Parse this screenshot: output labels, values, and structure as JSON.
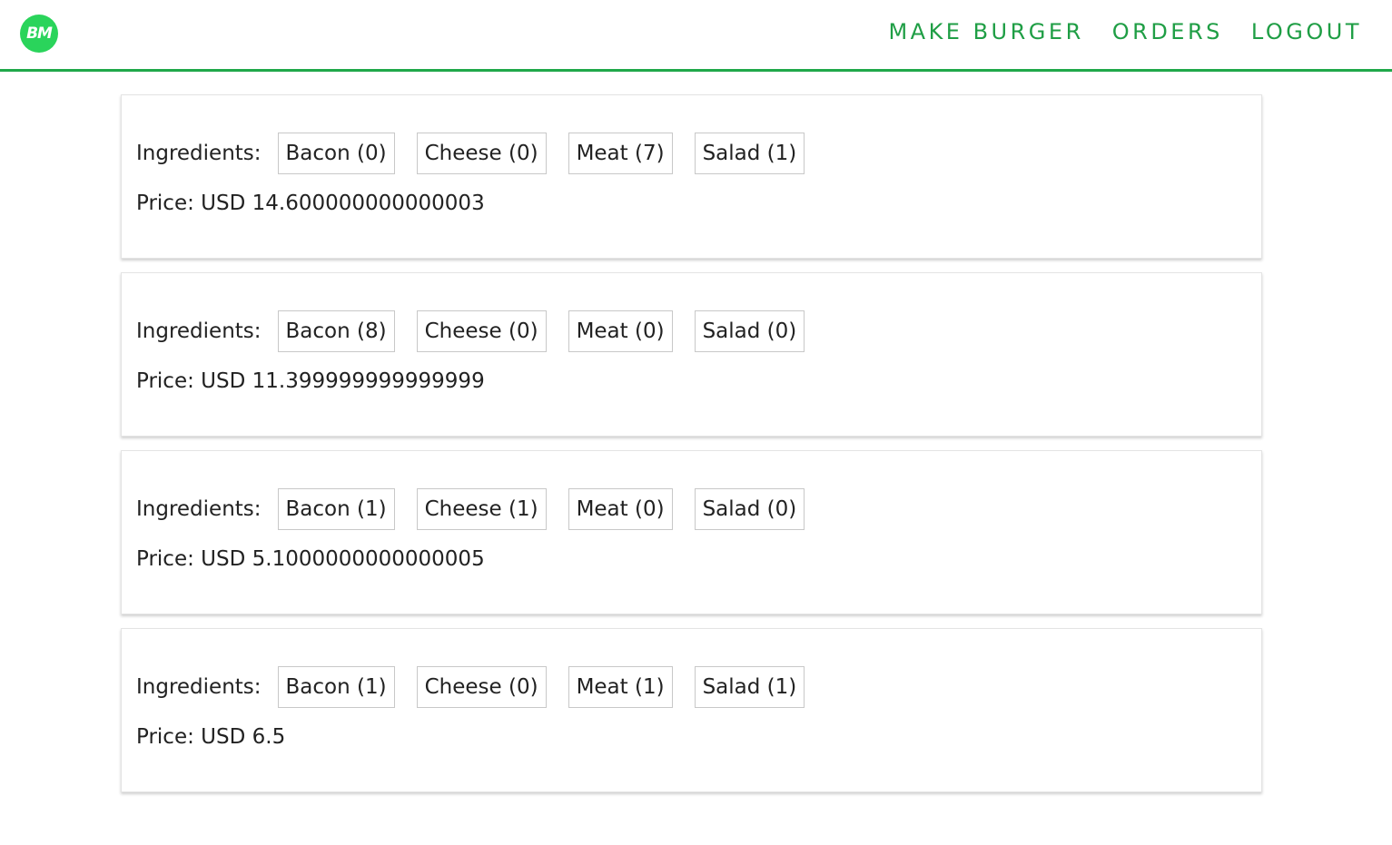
{
  "header": {
    "logo_text": "BM",
    "nav": [
      {
        "label": "MAKE BURGER"
      },
      {
        "label": "ORDERS"
      },
      {
        "label": "LOGOUT"
      }
    ]
  },
  "colors": {
    "accent": "#1f9e45",
    "logo_bg": "#2ad45b"
  },
  "ingredients_label": "Ingredients:",
  "orders": [
    {
      "ingredients": [
        "Bacon (0)",
        "Cheese (0)",
        "Meat (7)",
        "Salad (1)"
      ],
      "price": "Price: USD 14.600000000000003"
    },
    {
      "ingredients": [
        "Bacon (8)",
        "Cheese (0)",
        "Meat (0)",
        "Salad (0)"
      ],
      "price": "Price: USD 11.399999999999999"
    },
    {
      "ingredients": [
        "Bacon (1)",
        "Cheese (1)",
        "Meat (0)",
        "Salad (0)"
      ],
      "price": "Price: USD 5.1000000000000005"
    },
    {
      "ingredients": [
        "Bacon (1)",
        "Cheese (0)",
        "Meat (1)",
        "Salad (1)"
      ],
      "price": "Price: USD 6.5"
    }
  ]
}
